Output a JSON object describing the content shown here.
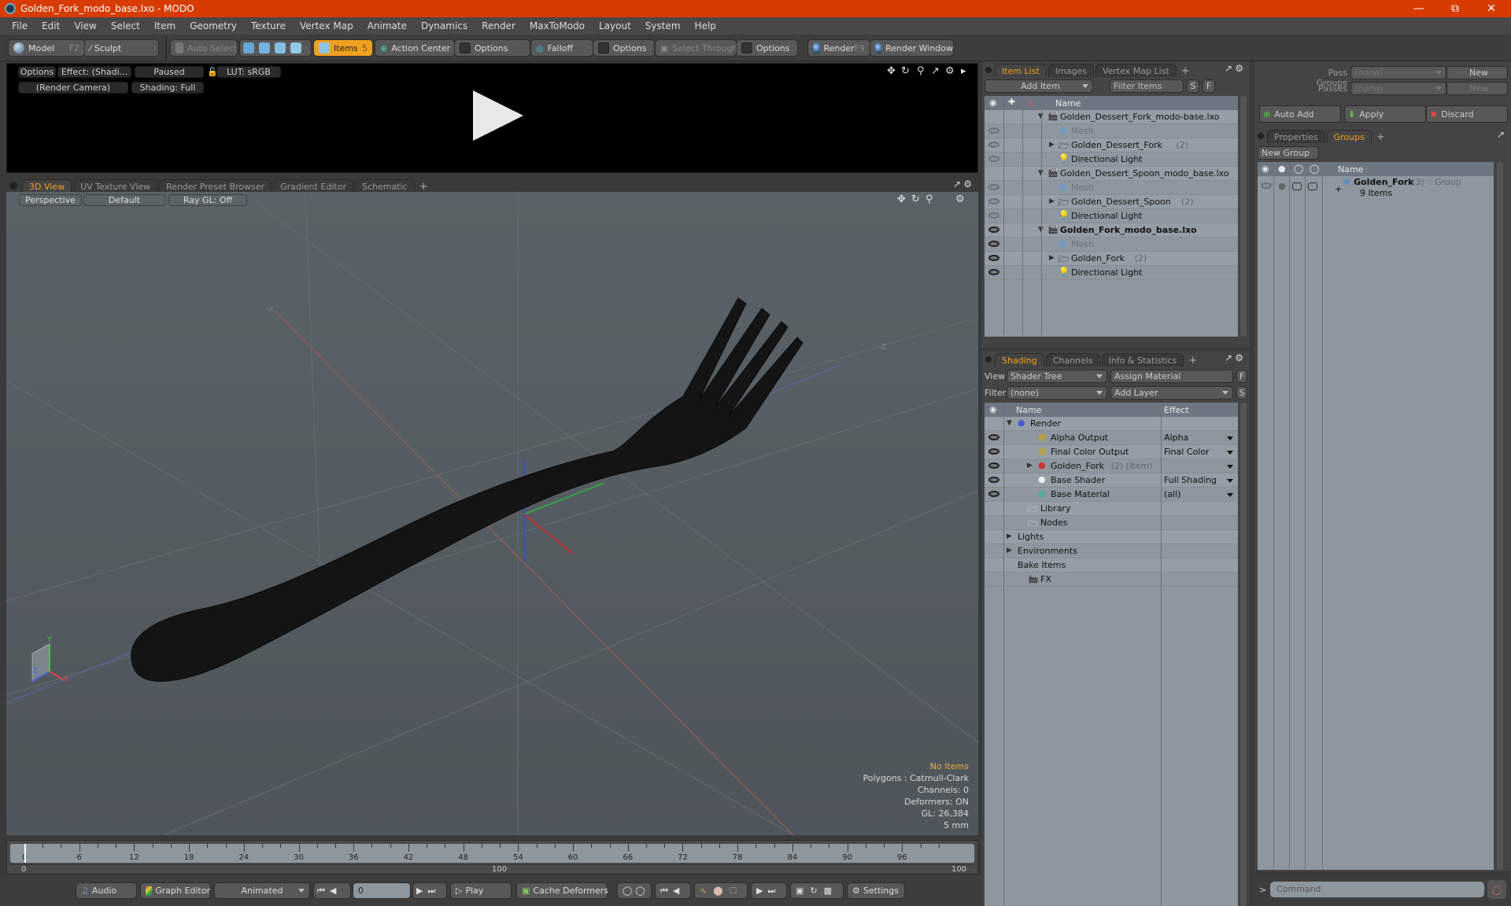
{
  "window": {
    "title": "Golden_Fork_modo_base.lxo - MODO",
    "controls": [
      "minimize",
      "restore",
      "close"
    ]
  },
  "menu": [
    "File",
    "Edit",
    "View",
    "Select",
    "Item",
    "Geometry",
    "Texture",
    "Vertex Map",
    "Animate",
    "Dynamics",
    "Render",
    "MaxToModo",
    "Layout",
    "System",
    "Help"
  ],
  "toolbar": {
    "model": "Model",
    "model_key": "F2",
    "sculpt": "Sculpt",
    "auto_select": "Auto Select",
    "items": "Items",
    "items_key": "5",
    "action_center": "Action Center",
    "options1": "Options",
    "falloff": "Falloff",
    "options2": "Options",
    "select_through": "Select Through",
    "options3": "Options",
    "render": "Render",
    "render_key": "F9",
    "render_window": "Render Window"
  },
  "preview": {
    "options": "Options",
    "effect": "Effect: (Shadi...",
    "paused": "Paused",
    "lut": "LUT: sRGB",
    "camera": "(Render Camera)",
    "shading": "Shading: Full"
  },
  "viewport_tabs": [
    {
      "label": "3D View",
      "active": true
    },
    {
      "label": "UV Texture View",
      "active": false
    },
    {
      "label": "Render Preset Browser",
      "active": false
    },
    {
      "label": "Gradient Editor",
      "active": false
    },
    {
      "label": "Schematic",
      "active": false
    }
  ],
  "viewport": {
    "projection": "Perspective",
    "style": "Default",
    "raygl": "Ray GL: Off",
    "stats": {
      "selection": "No Items",
      "polygons": "Polygons : Catmull-Clark",
      "channels": "Channels: 0",
      "deformers": "Deformers: ON",
      "gl": "GL: 26,384",
      "scale": "5 mm"
    },
    "axis_labels": {
      "x": "X",
      "y": "Y",
      "z": "Z"
    }
  },
  "timeline": {
    "ticks": [
      "0",
      "6",
      "12",
      "18",
      "24",
      "30",
      "36",
      "42",
      "48",
      "54",
      "60",
      "66",
      "72",
      "78",
      "84",
      "90",
      "96"
    ],
    "range_start": "0",
    "range_mid": "100",
    "range_end": "100",
    "current_frame": "0"
  },
  "bottombar": {
    "audio": "Audio",
    "graph_editor": "Graph Editor",
    "animated": "Animated",
    "frame": "0",
    "play": "Play",
    "cache_deformers": "Cache Deformers",
    "settings": "Settings"
  },
  "item_list": {
    "tabs": [
      {
        "label": "Item List",
        "active": true
      },
      {
        "label": "Images",
        "active": false
      },
      {
        "label": "Vertex Map List",
        "active": false
      }
    ],
    "add_item": "Add Item",
    "filter_placeholder": "Filter Items",
    "s_btn": "S",
    "f_btn": "F",
    "column_name": "Name",
    "rows": [
      {
        "label": "Golden_Dessert_Fork_modo-base.lxo",
        "level": 0,
        "type": "scene",
        "expanded": true,
        "eye": "none"
      },
      {
        "label": "Mesh",
        "level": 1,
        "type": "mesh",
        "dim": true,
        "eye": "dim"
      },
      {
        "label": "Golden_Dessert_Fork",
        "count": "(2)",
        "level": 1,
        "type": "group",
        "collapsed": true,
        "eye": "dim"
      },
      {
        "label": "Directional Light",
        "level": 1,
        "type": "light",
        "eye": "dim"
      },
      {
        "label": "Golden_Dessert_Spoon_modo_base.lxo",
        "level": 0,
        "type": "scene",
        "expanded": true,
        "eye": "none"
      },
      {
        "label": "Mesh",
        "level": 1,
        "type": "mesh",
        "dim": true,
        "eye": "dim"
      },
      {
        "label": "Golden_Dessert_Spoon",
        "count": "(2)",
        "level": 1,
        "type": "group",
        "collapsed": true,
        "eye": "dim"
      },
      {
        "label": "Directional Light",
        "level": 1,
        "type": "light",
        "eye": "dim"
      },
      {
        "label": "Golden_Fork_modo_base.lxo",
        "level": 0,
        "type": "scene",
        "expanded": true,
        "bold": true,
        "eye": "on"
      },
      {
        "label": "Mesh",
        "level": 1,
        "type": "mesh",
        "dim": true,
        "eye": "on"
      },
      {
        "label": "Golden_Fork",
        "count": "(2)",
        "level": 1,
        "type": "group",
        "collapsed": true,
        "eye": "on"
      },
      {
        "label": "Directional Light",
        "level": 1,
        "type": "light",
        "eye": "on"
      }
    ]
  },
  "shading": {
    "tabs": [
      {
        "label": "Shading",
        "active": true
      },
      {
        "label": "Channels",
        "active": false
      },
      {
        "label": "Info & Statistics",
        "active": false
      }
    ],
    "view_label": "View",
    "view_value": "Shader Tree",
    "assign_material": "Assign Material",
    "filter_label": "Filter",
    "filter_value": "(none)",
    "add_layer": "Add Layer",
    "f_btn": "F",
    "s_btn": "S",
    "col_name": "Name",
    "col_effect": "Effect",
    "rows": [
      {
        "label": "Render",
        "level": 0,
        "icon": "render-sphere",
        "expanded": true,
        "effect": "",
        "eye": false
      },
      {
        "label": "Alpha Output",
        "level": 1,
        "icon": "output",
        "effect": "Alpha",
        "eye": true
      },
      {
        "label": "Final Color Output",
        "level": 1,
        "icon": "output",
        "effect": "Final Color",
        "eye": true
      },
      {
        "label": "Golden_Fork",
        "suffix": "(2) (Item)",
        "level": 1,
        "icon": "material-group",
        "collapsed": true,
        "effect": "",
        "eye": true
      },
      {
        "label": "Base Shader",
        "level": 1,
        "icon": "shader",
        "effect": "Full Shading",
        "eye": true
      },
      {
        "label": "Base Material",
        "level": 1,
        "icon": "material",
        "effect": "(all)",
        "eye": true
      },
      {
        "label": "Library",
        "level": 0.5,
        "icon": "folder",
        "effect": "",
        "eye": false
      },
      {
        "label": "Nodes",
        "level": 0.5,
        "icon": "folder",
        "effect": "",
        "eye": false
      },
      {
        "label": "Lights",
        "level": 0,
        "icon": "none",
        "collapsed": true,
        "effect": "",
        "eye": false
      },
      {
        "label": "Environments",
        "level": 0,
        "icon": "none",
        "collapsed": true,
        "effect": "",
        "eye": false
      },
      {
        "label": "Bake Items",
        "level": 0,
        "icon": "none",
        "effect": "",
        "eye": false
      },
      {
        "label": "FX",
        "level": 0.5,
        "icon": "clapper",
        "effect": "",
        "eye": false
      }
    ]
  },
  "passes": {
    "pass_groups_label": "Pass Groups",
    "pass_groups_value": "(none)",
    "passes_label": "Passes",
    "passes_value": "(none)",
    "new1": "New",
    "new2": "New",
    "auto_add": "Auto Add",
    "apply": "Apply",
    "discard": "Discard"
  },
  "groups": {
    "tabs": [
      {
        "label": "Properties",
        "active": false
      },
      {
        "label": "Groups",
        "active": true
      }
    ],
    "new_group": "New Group",
    "col_name": "Name",
    "item_name": "Golden_Fork",
    "item_count": "(3)",
    "item_type": ": Group",
    "item_sub": "9 Items"
  },
  "command": {
    "prompt": ">",
    "placeholder": "Command"
  },
  "colors": {
    "titlebar": "#d83b01",
    "accent": "#f0a020",
    "tree_bg": "#8e979f",
    "viewport_bg": "#575e63"
  }
}
